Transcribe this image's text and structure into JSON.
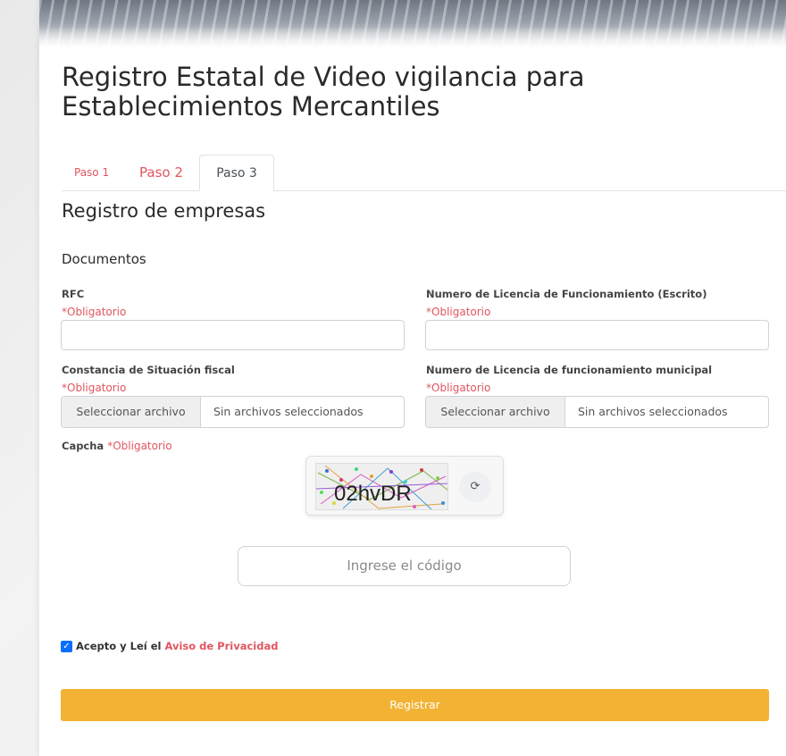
{
  "header": {
    "title": "Registro Estatal de Video vigilancia para Establecimientos Mercantiles"
  },
  "tabs": [
    {
      "label": "Paso 1"
    },
    {
      "label": "Paso 2"
    },
    {
      "label": "Paso 3",
      "active": true
    }
  ],
  "section": {
    "title": "Registro de empresas",
    "subtitle": "Documentos"
  },
  "fields": {
    "rfc": {
      "label": "RFC",
      "required": "*Obligatorio",
      "value": ""
    },
    "licencia_escrito": {
      "label": "Numero de Licencia de Funcionamiento (Escrito)",
      "required": "*Obligatorio",
      "value": ""
    },
    "constancia": {
      "label": "Constancia de Situación fiscal",
      "required": "*Obligatorio",
      "button": "Seleccionar archivo",
      "status": "Sin archivos seleccionados"
    },
    "licencia_municipal": {
      "label": "Numero de Licencia de funcionamiento municipal",
      "required": "*Obligatorio",
      "button": "Seleccionar archivo",
      "status": "Sin archivos seleccionados"
    }
  },
  "captcha": {
    "label": "Capcha",
    "required": "*Obligatorio",
    "code": "02hvDR",
    "refresh_icon": "refresh-icon",
    "placeholder": "Ingrese el código"
  },
  "privacy": {
    "checked": true,
    "text": "Acepto y Leí el",
    "link": "Aviso de Privacidad"
  },
  "submit": {
    "label": "Registrar"
  },
  "colors": {
    "accent": "#e0565f",
    "button": "#f2b233",
    "checkbox": "#0d6efd"
  }
}
